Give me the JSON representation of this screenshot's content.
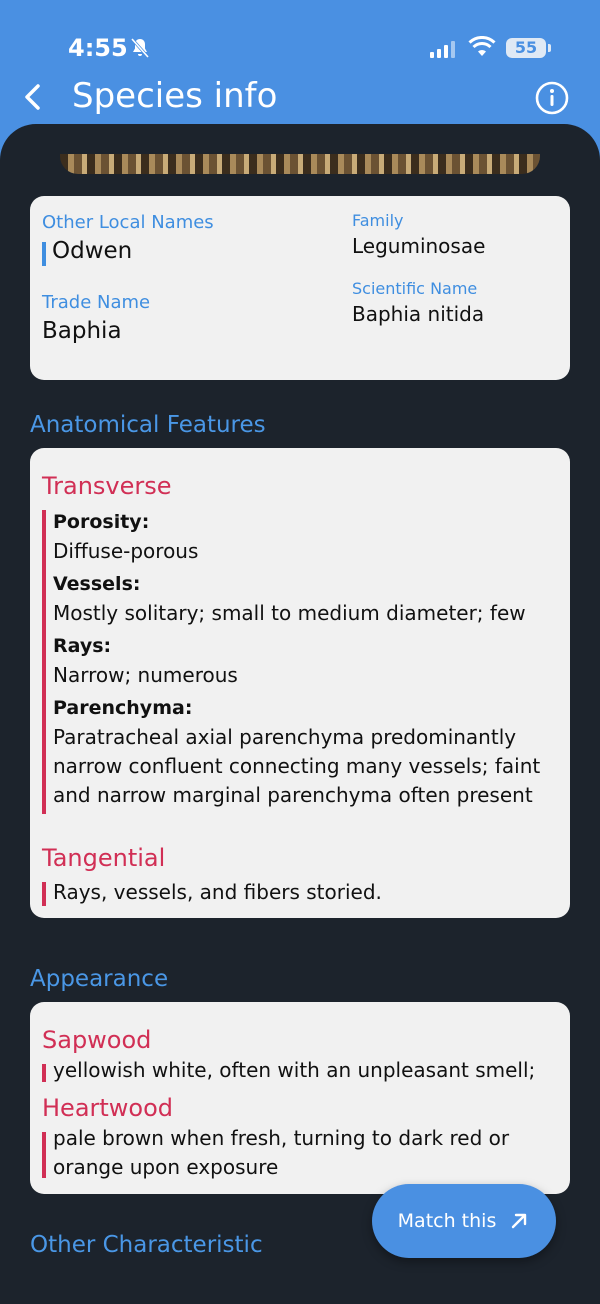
{
  "status": {
    "time": "4:55",
    "battery": "55"
  },
  "appbar": {
    "title": "Species info"
  },
  "names": {
    "other_local_label": "Other Local Names",
    "other_local_value": "Odwen",
    "trade_label": "Trade Name",
    "trade_value": "Baphia",
    "family_label": "Family",
    "family_value": "Leguminosae",
    "scientific_label": "Scientific Name",
    "scientific_value": "Baphia nitida"
  },
  "anatomical": {
    "title": "Anatomical Features",
    "transverse": {
      "heading": "Transverse",
      "features": [
        {
          "key": "Porosity:",
          "value": "Diffuse-porous"
        },
        {
          "key": "Vessels:",
          "value": "Mostly solitary; small to medium diameter; few"
        },
        {
          "key": "Rays:",
          "value": "Narrow; numerous"
        },
        {
          "key": "Parenchyma:",
          "value": "Paratracheal axial parenchyma predominantly narrow confluent connecting many vessels; faint and narrow  marginal parenchyma often present"
        }
      ]
    },
    "tangential": {
      "heading": "Tangential",
      "value": "Rays, vessels, and fibers storied."
    }
  },
  "appearance": {
    "title": "Appearance",
    "sapwood_heading": "Sapwood",
    "sapwood_value": "yellowish white, often with an unpleasant smell;",
    "heartwood_heading": "Heartwood",
    "heartwood_value": "pale brown when fresh, turning to dark red or orange upon exposure"
  },
  "other": {
    "title": "Other Characteristic"
  },
  "fab": {
    "label": "Match this"
  }
}
